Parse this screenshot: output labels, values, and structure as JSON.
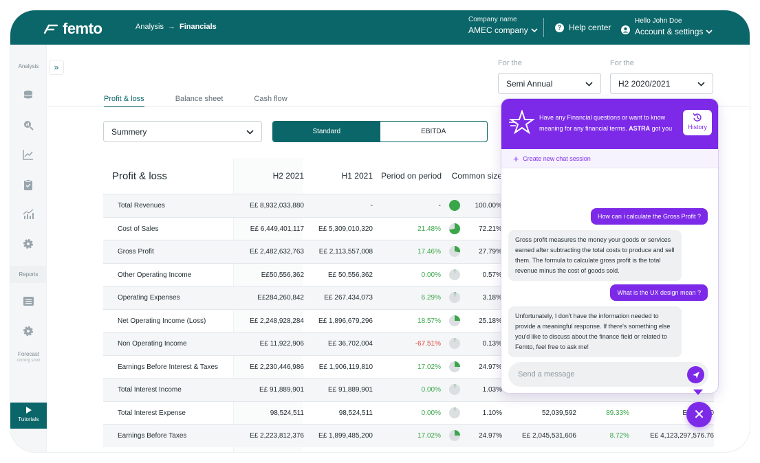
{
  "header": {
    "logo": "femto",
    "breadcrumb": [
      "Analysis",
      "Financials"
    ],
    "company_label": "Company name",
    "company_value": "AMEC company",
    "help_label": "Help center",
    "greeting": "Hello John Doe",
    "account_label": "Account & settings"
  },
  "sidebar": {
    "analysis_label": "Analysis",
    "reports_label": "Reports",
    "forecast_label": "Forecast",
    "forecast_note": "coming soon",
    "tutorials_label": "Tutorials"
  },
  "filters": {
    "period_label_1": "For the",
    "period_value_1": "Semi Annual",
    "period_label_2": "For the",
    "period_value_2": "H2 2020/2021"
  },
  "tabs": [
    {
      "label": "Profit & loss",
      "active": true
    },
    {
      "label": "Balance sheet",
      "active": false
    },
    {
      "label": "Cash flow",
      "active": false
    }
  ],
  "view_select": "Summery",
  "toggle": {
    "standard": "Standard",
    "ebitda": "EBITDA",
    "selected": "Standard"
  },
  "table": {
    "title": "Profit & loss",
    "columns": [
      "H2 2021",
      "H1 2021",
      "Period on period",
      "Common size"
    ],
    "rows": [
      {
        "label": "Total Revenues",
        "h2": "E£ 8,932,033,880",
        "h1": "-",
        "pop": "-",
        "pop_color": "neutral",
        "cs": "100.00%",
        "cs_frac": 1.0,
        "extra": [
          "",
          "",
          ""
        ]
      },
      {
        "label": "Cost of Sales",
        "h2": "E£ 6,449,401,117",
        "h1": "E£ 5,309,010,320",
        "pop": "21.48%",
        "pop_color": "green",
        "cs": "72.21%",
        "cs_frac": 0.7221,
        "extra": [
          "",
          "",
          ""
        ]
      },
      {
        "label": "Gross Profit",
        "h2": "E£ 2,482,632,763",
        "h1": "E£ 2,113,557,008",
        "pop": "17.46%",
        "pop_color": "green",
        "cs": "27.79%",
        "cs_frac": 0.2779,
        "extra": [
          "",
          "",
          ""
        ]
      },
      {
        "label": "Other Operating Income",
        "h2": "E£50,556,362",
        "h1": "E£ 50,556,362",
        "pop": "0.00%",
        "pop_color": "green",
        "cs": "0.57%",
        "cs_frac": 0.0057,
        "extra": [
          "",
          "",
          ""
        ]
      },
      {
        "label": "Operating Expenses",
        "h2": "E£284,260,842",
        "h1": "E£ 267,434,073",
        "pop": "6.29%",
        "pop_color": "green",
        "cs": "3.18%",
        "cs_frac": 0.0318,
        "extra": [
          "",
          "",
          ""
        ]
      },
      {
        "label": "Net Operating Income (Loss)",
        "h2": "E£ 2,248,928,284",
        "h1": "E£ 1,896,679,296",
        "pop": "18.57%",
        "pop_color": "green",
        "cs": "25.18%",
        "cs_frac": 0.2518,
        "extra": [
          "",
          "",
          ""
        ]
      },
      {
        "label": "Non Operating Income",
        "h2": "E£ 11,922,906",
        "h1": "E£ 36,702,004",
        "pop": "-67.51%",
        "pop_color": "red",
        "cs": "0.13%",
        "cs_frac": 0.0013,
        "extra": [
          "",
          "",
          ""
        ]
      },
      {
        "label": "Earnings Before Interest & Taxes",
        "h2": "E£ 2,230,446,986",
        "h1": "E£ 1,906,119,810",
        "pop": "17.02%",
        "pop_color": "green",
        "cs": "24.97%",
        "cs_frac": 0.2497,
        "extra": [
          "",
          "",
          ""
        ]
      },
      {
        "label": "Total Interest Income",
        "h2": "E£ 91,889,901",
        "h1": "E£ 91,889,901",
        "pop": "0.00%",
        "pop_color": "green",
        "cs": "1.03%",
        "cs_frac": 0.0103,
        "extra": [
          "",
          "",
          ""
        ]
      },
      {
        "label": "Total Interest Expense",
        "h2": "98,524,511",
        "h1": "98,524,511",
        "pop": "0.00%",
        "pop_color": "green",
        "cs": "1.10%",
        "cs_frac": 0.011,
        "extra": [
          "52,039,592",
          "89.33%",
          "E£ 16,420"
        ]
      },
      {
        "label": "Earnings Before Taxes",
        "h2": "E£ 2,223,812,376",
        "h1": "E£ 1,899,485,200",
        "pop": "17.02%",
        "pop_color": "green",
        "cs": "24.97%",
        "cs_frac": 0.2497,
        "extra": [
          "E£ 2,045,531,606",
          "8.72%",
          "E£ 4,123,297,576.76"
        ]
      }
    ]
  },
  "chat": {
    "intro_text": "Have any Financial questions or want to know meaning for any financial terms.",
    "intro_brand": "ASTRA",
    "intro_tail": "got you",
    "history_label": "History",
    "new_session": "Create new chat session",
    "messages": [
      {
        "from": "user",
        "text": "How can i calculate the Gross Profit ?"
      },
      {
        "from": "bot",
        "text": "Gross profit measures the money your goods or services earned after subtracting the total costs to produce and sell them. The formula to calculate gross profit is the total revenue minus the cost of goods sold."
      },
      {
        "from": "user",
        "text": "What is the UX design mean ?"
      },
      {
        "from": "bot",
        "text": "Unfortunately, I don't have the information needed to provide a meaningful response. If there's something else you'd like to discuss about the finance field or related to Femto, feel free to ask me!"
      }
    ],
    "input_placeholder": "Send a message"
  },
  "colors": {
    "brand": "#0b6669",
    "chat_accent": "#7c2ae8",
    "positive": "#3aa64a",
    "negative": "#e0463c",
    "pie_fill": "#3aa64a"
  },
  "icons": [
    "femto-logo-icon",
    "arrow-right-icon",
    "chevron-down-icon",
    "help-icon",
    "user-icon",
    "database-icon",
    "search-chart-icon",
    "line-chart-icon",
    "clipboard-icon",
    "bar-trend-icon",
    "gear-icon",
    "list-icon",
    "play-icon",
    "double-chevron-right-icon",
    "astra-star-icon",
    "history-icon",
    "plus-icon",
    "send-icon",
    "close-icon"
  ]
}
